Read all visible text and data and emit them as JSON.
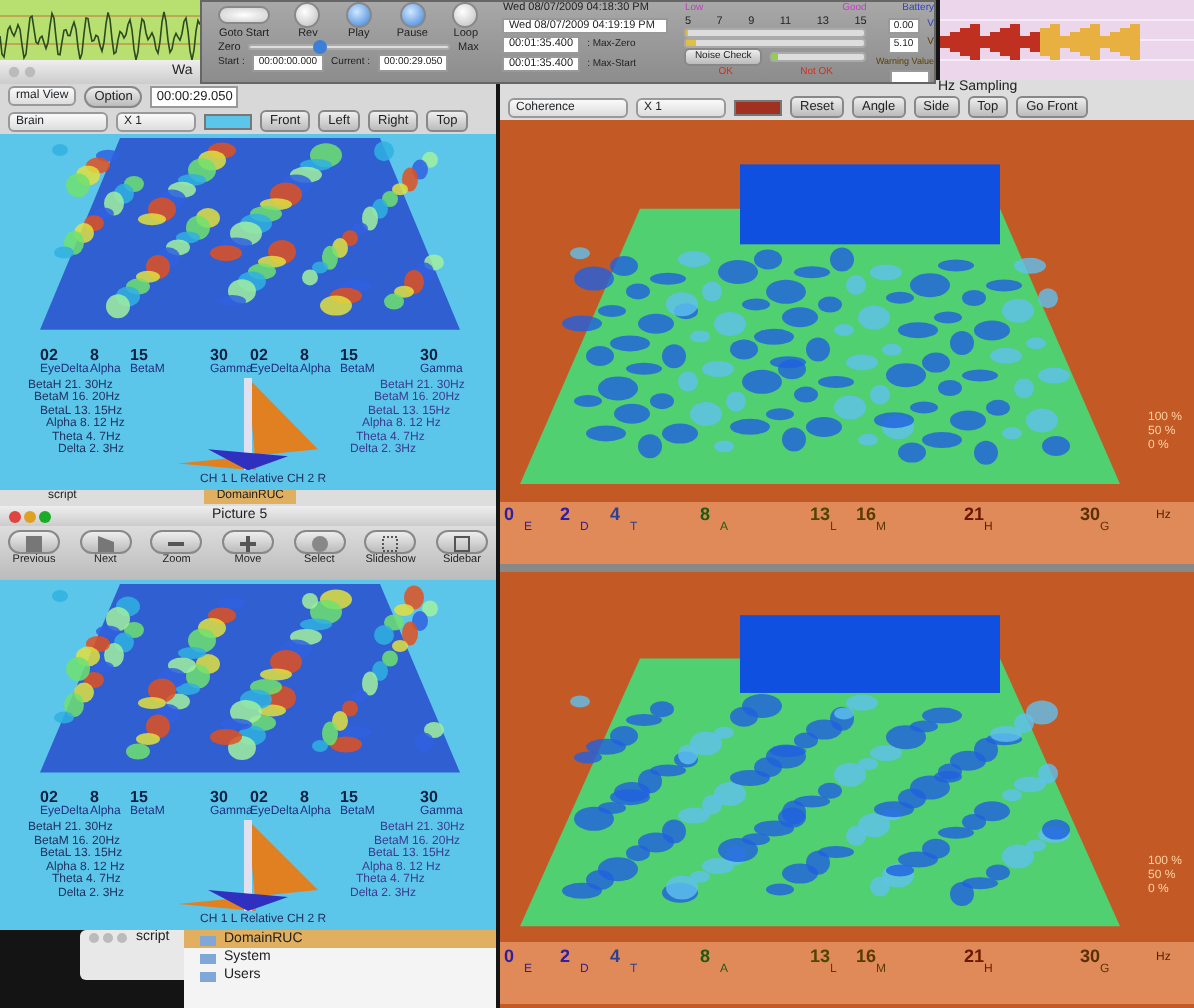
{
  "wave_window": {
    "title": "Wa"
  },
  "left_view": {
    "view_select": "rmal View",
    "option_button": "Option",
    "time": "00:00:29.050",
    "region_select": "Brain",
    "scale_select": "X 1",
    "buttons": [
      "Front",
      "Left",
      "Right",
      "Top"
    ]
  },
  "left_plots": [
    {
      "freq_labels": [
        {
          "value": "02",
          "band": "EyeDelta"
        },
        {
          "value": "8",
          "band": "Alpha"
        },
        {
          "value": "15",
          "band": "BetaM"
        },
        {
          "value": "30",
          "band": "Gamma"
        },
        {
          "value": "02",
          "band": "EyeDelta"
        },
        {
          "value": "8",
          "band": "Alpha"
        },
        {
          "value": "15",
          "band": "BetaM"
        },
        {
          "value": "30",
          "band": "Gamma"
        }
      ],
      "band_labels_left": [
        "BetaH 21. 30Hz",
        "BetaM 16. 20Hz",
        "BetaL 13. 15Hz",
        "Alpha 8. 12 Hz",
        "Theta 4. 7Hz",
        "Delta 2. 3Hz"
      ],
      "band_labels_right": [
        "BetaH 21. 30Hz",
        "BetaM 16. 20Hz",
        "BetaL 13. 15Hz",
        "Alpha 8. 12 Hz",
        "Theta 4. 7Hz",
        "Delta 2. 3Hz"
      ],
      "bottom_label": "CH 1 L Relative CH 2 R"
    },
    {
      "freq_labels": [
        {
          "value": "02",
          "band": "EyeDelta"
        },
        {
          "value": "8",
          "band": "Alpha"
        },
        {
          "value": "15",
          "band": "BetaM"
        },
        {
          "value": "30",
          "band": "Gamma"
        },
        {
          "value": "02",
          "band": "EyeDelta"
        },
        {
          "value": "8",
          "band": "Alpha"
        },
        {
          "value": "15",
          "band": "BetaM"
        },
        {
          "value": "30",
          "band": "Gamma"
        }
      ],
      "band_labels_left": [
        "BetaH 21. 30Hz",
        "BetaM 16. 20Hz",
        "BetaL 13. 15Hz",
        "Alpha 8. 12 Hz",
        "Theta 4. 7Hz",
        "Delta 2. 3Hz"
      ],
      "band_labels_right": [
        "BetaH 21. 30Hz",
        "BetaM 16. 20Hz",
        "BetaL 13. 15Hz",
        "Alpha 8. 12 Hz",
        "Theta 4. 7Hz",
        "Delta 2. 3Hz"
      ],
      "bottom_label": "CH 1 L Relative CH 2 R"
    }
  ],
  "controls": {
    "transport": [
      {
        "label": "Goto Start",
        "kind": "oval"
      },
      {
        "label": "Rev",
        "kind": "plain"
      },
      {
        "label": "Play",
        "kind": "blue"
      },
      {
        "label": "Pause",
        "kind": "blue"
      },
      {
        "label": "Loop",
        "kind": "plain"
      }
    ],
    "slider": {
      "min_label": "Zero",
      "max_label": "Max",
      "level": 0.35
    },
    "start": {
      "label": "Start :",
      "value": "00:00:00.000"
    },
    "current": {
      "label": "Current :",
      "value": "00:00:29.050"
    },
    "clock": "Wed 08/07/2009 04:18:30 PM",
    "date_field": "Wed 08/07/2009 04:19:19 PM",
    "max_zero": {
      "value": "00:01:35.400",
      "label": ": Max-Zero"
    },
    "max_start": {
      "value": "00:01:35.400",
      "label": ": Max-Start"
    },
    "scale": {
      "low": "Low",
      "good": "Good",
      "ticks": [
        "5",
        "7",
        "9",
        "11",
        "13",
        "15"
      ]
    },
    "bars": [
      {
        "level": 0,
        "color": "#e0c040"
      },
      {
        "level": 0.05,
        "color": "#e0c040"
      },
      {
        "level": 0.07,
        "color": "#8fd050"
      }
    ],
    "noise_button": "Noise Check",
    "ok": "OK",
    "not_ok": "Not OK",
    "battery": {
      "title": "Battery",
      "value": "0.00",
      "unit": "V",
      "warning_value": "5.10",
      "warning_unit": "V",
      "warning_label": "Warning Value"
    }
  },
  "right_view": {
    "sampling": "Hz Sampling",
    "mode_select": "Coherence",
    "scale_select": "X 1",
    "buttons": [
      "Reset",
      "Angle",
      "Side",
      "Top",
      "Go Front"
    ]
  },
  "right_plots": [
    {
      "ticks": [
        {
          "value": "0",
          "band": "E"
        },
        {
          "value": "2",
          "band": "D"
        },
        {
          "value": "4",
          "band": "T"
        },
        {
          "value": "8",
          "band": "A"
        },
        {
          "value": "13",
          "band": "L"
        },
        {
          "value": "16",
          "band": "M"
        },
        {
          "value": "21",
          "band": "H"
        },
        {
          "value": "30",
          "band": "G"
        }
      ],
      "unit": "Hz",
      "percent": [
        "100 %",
        "50 %",
        "0 %"
      ]
    },
    {
      "ticks": [
        {
          "value": "0",
          "band": "E"
        },
        {
          "value": "2",
          "band": "D"
        },
        {
          "value": "4",
          "band": "T"
        },
        {
          "value": "8",
          "band": "A"
        },
        {
          "value": "13",
          "band": "L"
        },
        {
          "value": "16",
          "band": "M"
        },
        {
          "value": "21",
          "band": "H"
        },
        {
          "value": "30",
          "band": "G"
        }
      ],
      "unit": "Hz",
      "percent": [
        "100 %",
        "50 %",
        "0 %"
      ]
    }
  ],
  "preview": {
    "title": "Picture 5",
    "tools": [
      "Previous",
      "Next",
      "Zoom",
      "Move",
      "Select",
      "Slideshow",
      "Sidebar"
    ]
  },
  "background_titles": [
    "script",
    "DomainRUC"
  ],
  "finder": {
    "script_window": "script",
    "items": [
      {
        "label": "DomainRUC",
        "selected": true
      },
      {
        "label": "System",
        "selected": false
      },
      {
        "label": "Users",
        "selected": false
      }
    ]
  }
}
